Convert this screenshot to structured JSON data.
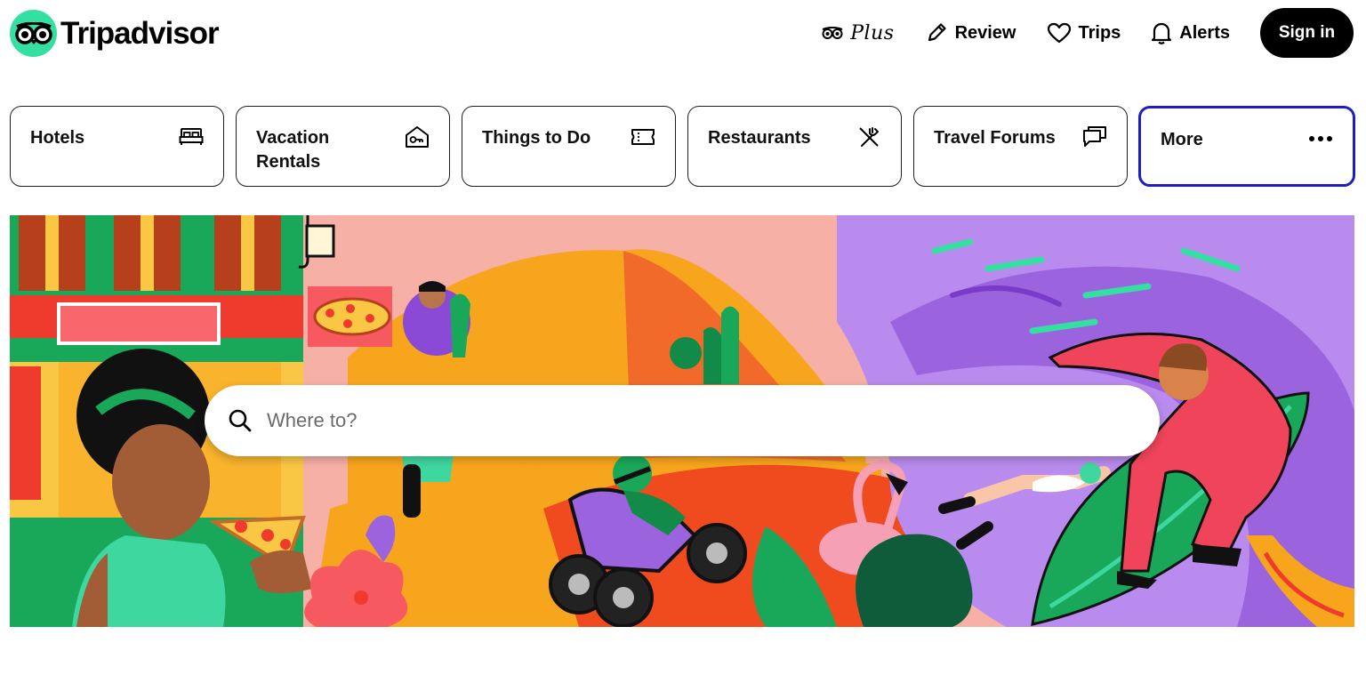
{
  "brand": {
    "name": "Tripadvisor",
    "accent": "#34e0a1"
  },
  "nav": {
    "plus_label": "Plus",
    "review_label": "Review",
    "trips_label": "Trips",
    "alerts_label": "Alerts",
    "signin_label": "Sign in"
  },
  "categories": [
    {
      "label": "Hotels",
      "icon": "bed-icon"
    },
    {
      "label": "Vacation Rentals",
      "icon": "house-key-icon"
    },
    {
      "label": "Things to Do",
      "icon": "ticket-icon"
    },
    {
      "label": "Restaurants",
      "icon": "fork-knife-icon"
    },
    {
      "label": "Travel Forums",
      "icon": "chat-bubbles-icon"
    },
    {
      "label": "More",
      "icon": "more-dots-icon"
    }
  ],
  "search": {
    "placeholder": "Where to?"
  },
  "colors": {
    "selected_border": "#1d1dc7",
    "signin_bg": "#000000"
  }
}
